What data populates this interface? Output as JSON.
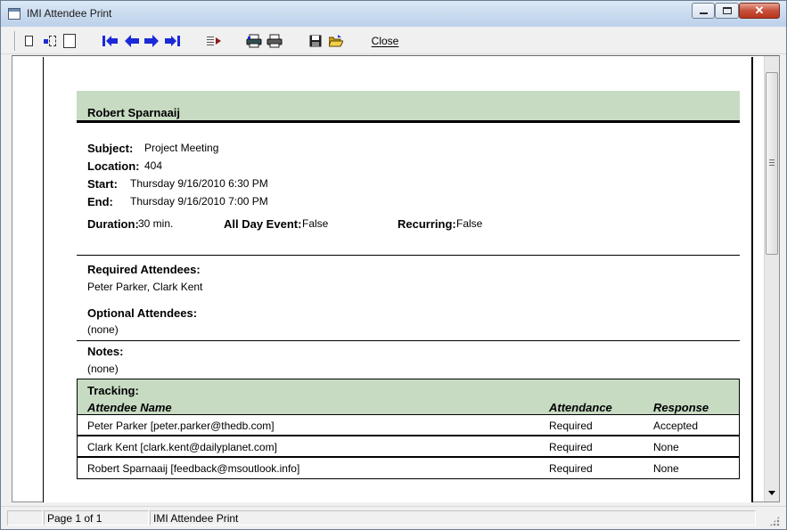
{
  "window": {
    "title": "IMI Attendee Print"
  },
  "toolbar": {
    "close_label": "Close"
  },
  "report": {
    "organizer": "Robert Sparnaaij",
    "subject_label": "Subject:",
    "subject": "Project Meeting",
    "location_label": "Location:",
    "location": "404",
    "start_label": "Start:",
    "start": "Thursday 9/16/2010 6:30 PM",
    "end_label": "End:",
    "end": "Thursday 9/16/2010 7:00 PM",
    "duration_label": "Duration:",
    "duration": "30 min.",
    "all_day_label": "All Day Event:",
    "all_day": "False",
    "recurring_label": "Recurring:",
    "recurring": "False",
    "required_label": "Required Attendees:",
    "required": "Peter Parker, Clark Kent",
    "optional_label": "Optional Attendees:",
    "optional": "(none)",
    "notes_label": "Notes:",
    "notes": "(none)",
    "tracking": {
      "title": "Tracking:",
      "headers": [
        "Attendee Name",
        "Attendance",
        "Response"
      ],
      "rows": [
        [
          "Peter Parker [peter.parker@thedb.com]",
          "Required",
          "Accepted"
        ],
        [
          "Clark Kent [clark.kent@dailyplanet.com]",
          "Required",
          "None"
        ],
        [
          "Robert Sparnaaij [feedback@msoutlook.info]",
          "Required",
          "None"
        ]
      ]
    }
  },
  "status": {
    "page": "Page 1 of 1",
    "title": "IMI Attendee Print"
  }
}
